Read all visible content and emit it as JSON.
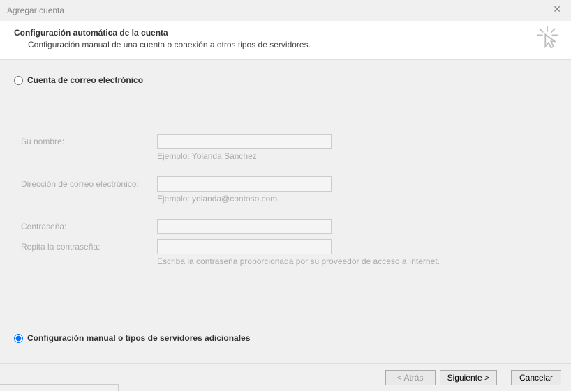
{
  "window": {
    "title": "Agregar cuenta"
  },
  "header": {
    "title": "Configuración automática de la cuenta",
    "subtitle": "Configuración manual de una cuenta o conexión a otros tipos de servidores."
  },
  "options": {
    "email_account_label": "Cuenta de correo electrónico",
    "manual_label": "Configuración manual o tipos de servidores adicionales"
  },
  "form": {
    "name": {
      "label": "Su nombre:",
      "value": "",
      "hint": "Ejemplo: Yolanda Sánchez"
    },
    "email": {
      "label": "Dirección de correo electrónico:",
      "value": "",
      "hint": "Ejemplo: yolanda@contoso.com"
    },
    "password": {
      "label": "Contraseña:",
      "value": ""
    },
    "password2": {
      "label": "Repita la contraseña:",
      "value": "",
      "hint": "Escriba la contraseña proporcionada por su proveedor de acceso a Internet."
    }
  },
  "buttons": {
    "back": "< Atrás",
    "next": "Siguiente >",
    "cancel": "Cancelar"
  }
}
